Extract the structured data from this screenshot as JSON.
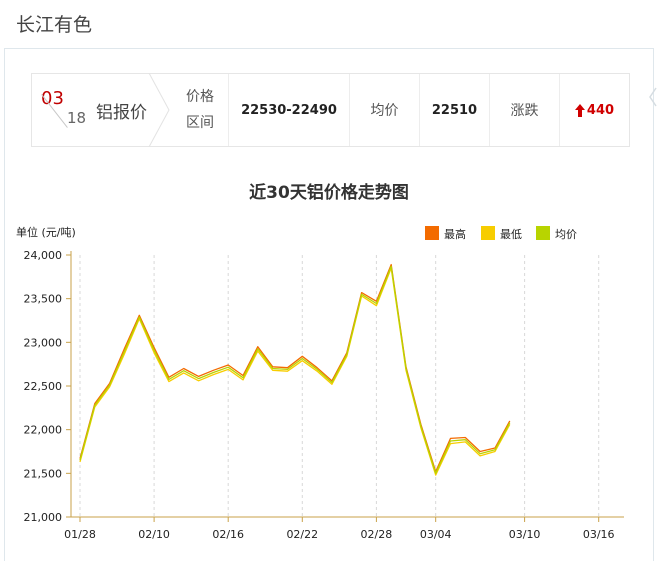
{
  "site": {
    "title": "长江有色"
  },
  "info": {
    "month": "03",
    "day": "18",
    "product": "铝报价",
    "range_label_1": "价格",
    "range_label_2": "区间",
    "range_value": "22530-22490",
    "avg_label": "均价",
    "avg_value": "22510",
    "change_label": "涨跌",
    "change_value": "440",
    "change_arrow": "up-arrow-icon"
  },
  "colors": {
    "high": "#f36b00",
    "low": "#f7cd00",
    "avg": "#b8d400",
    "change_up": "#d00000"
  },
  "chart_data": {
    "type": "line",
    "title": "近30天铝价格走势图",
    "ylabel": "单位 (元/吨)",
    "xlabel": "",
    "ylim": [
      21000,
      24000
    ],
    "yticks": [
      "21,000",
      "21,500",
      "22,000",
      "22,500",
      "23,000",
      "23,500",
      "24,000"
    ],
    "ytick_values": [
      21000,
      21500,
      22000,
      22500,
      23000,
      23500,
      24000
    ],
    "xticks": [
      "01/28",
      "02/10",
      "02/16",
      "02/22",
      "02/28",
      "03/04",
      "03/10",
      "03/16"
    ],
    "xtick_index": [
      0,
      5,
      10,
      15,
      20,
      24,
      30,
      35
    ],
    "grid": true,
    "legend_position": "top-right",
    "series": [
      {
        "name": "最高",
        "color": "#f36b00",
        "values": [
          21670,
          22300,
          22530,
          22930,
          23310,
          22940,
          22600,
          22700,
          22610,
          22680,
          22740,
          22620,
          22950,
          22720,
          22710,
          22840,
          22710,
          22560,
          22880,
          23570,
          23470,
          23890,
          22720,
          22060,
          21520,
          21900,
          21910,
          21750,
          21790,
          22100
        ]
      },
      {
        "name": "最低",
        "color": "#f7cd00",
        "values": [
          21630,
          22260,
          22490,
          22870,
          23270,
          22880,
          22550,
          22650,
          22560,
          22630,
          22690,
          22570,
          22900,
          22680,
          22670,
          22790,
          22670,
          22520,
          22840,
          23530,
          23420,
          23850,
          22680,
          22020,
          21480,
          21840,
          21860,
          21700,
          21750,
          22060
        ]
      },
      {
        "name": "均价",
        "color": "#b8d400",
        "values": [
          21650,
          22280,
          22510,
          22900,
          23290,
          22910,
          22575,
          22675,
          22585,
          22655,
          22715,
          22595,
          22925,
          22700,
          22690,
          22815,
          22690,
          22540,
          22860,
          23550,
          23445,
          23870,
          22700,
          22040,
          21500,
          21870,
          21885,
          21725,
          21770,
          22080
        ]
      }
    ]
  }
}
